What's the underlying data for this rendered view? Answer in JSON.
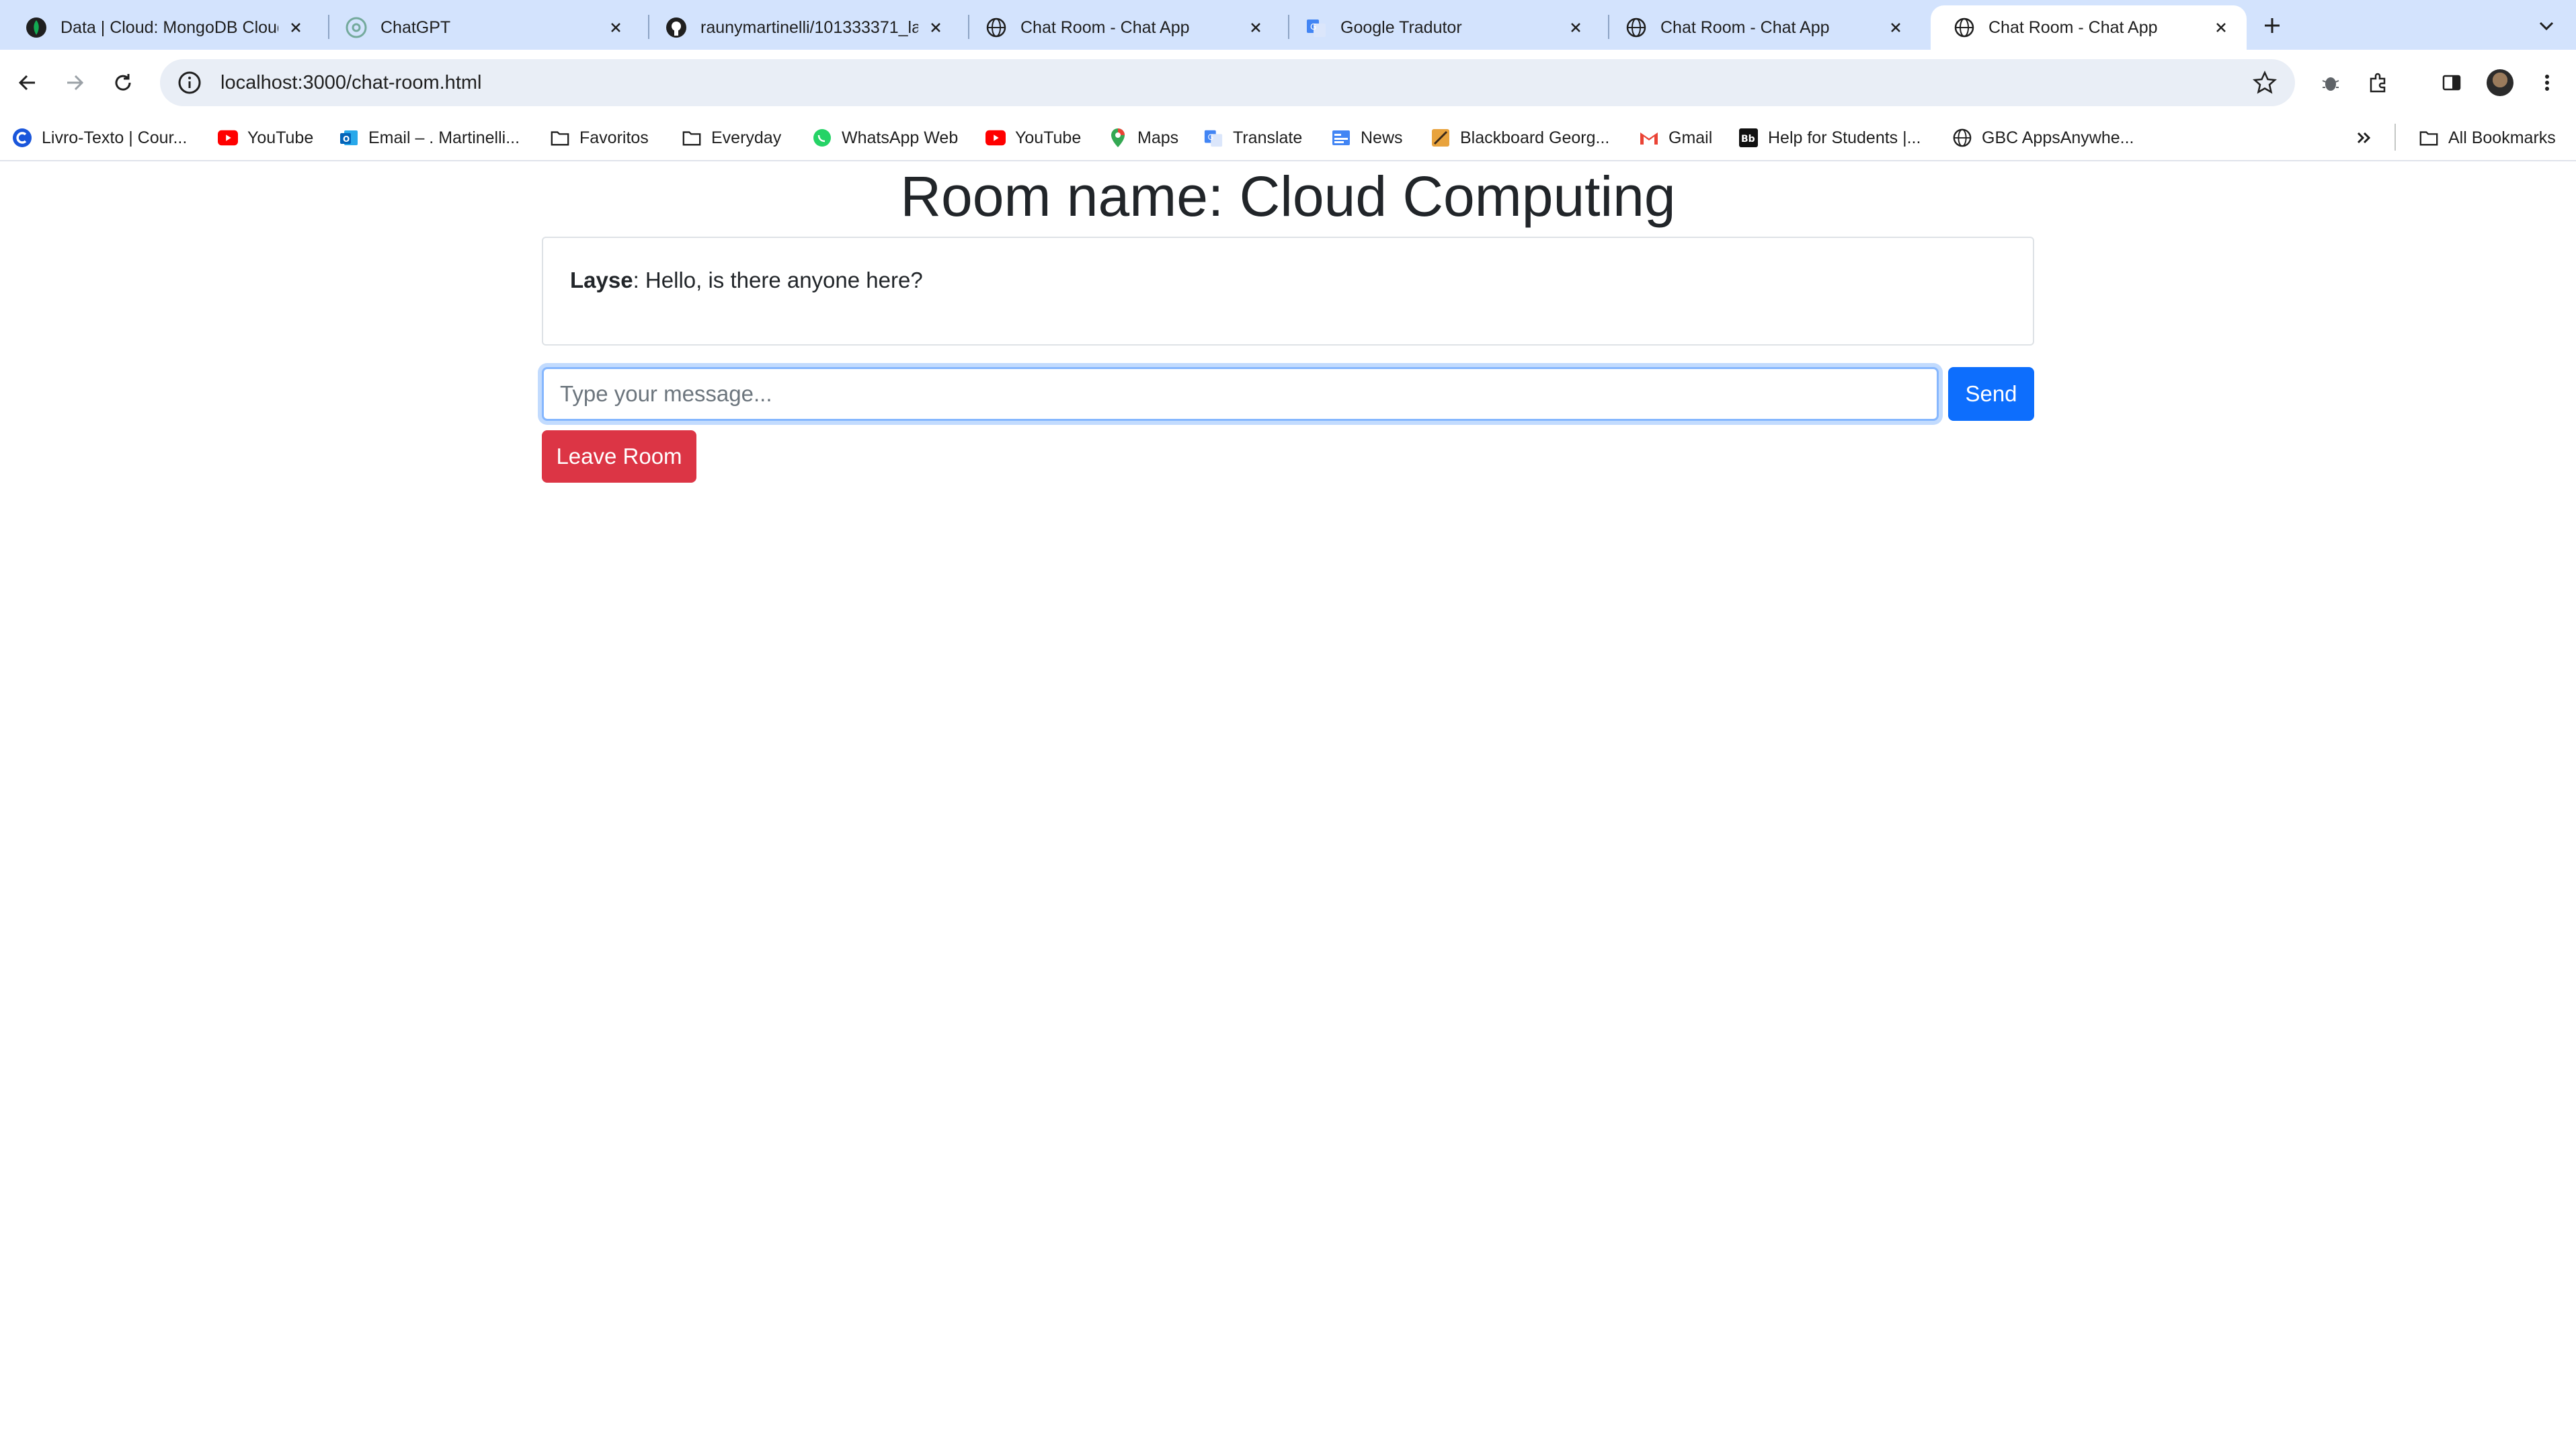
{
  "browser": {
    "tabs": [
      {
        "title": "Data | Cloud: MongoDB Cloud",
        "icon": "mongodb-leaf-icon",
        "active": false
      },
      {
        "title": "ChatGPT",
        "icon": "chatgpt-icon",
        "active": false
      },
      {
        "title": "raunymartinelli/101333371_la",
        "icon": "github-icon",
        "active": false
      },
      {
        "title": "Chat Room - Chat App",
        "icon": "globe-icon",
        "active": false
      },
      {
        "title": "Google Tradutor",
        "icon": "google-translate-icon",
        "active": false
      },
      {
        "title": "Chat Room - Chat App",
        "icon": "globe-icon",
        "active": false
      },
      {
        "title": "Chat Room - Chat App",
        "icon": "globe-icon",
        "active": true
      }
    ],
    "url": "localhost:3000/chat-room.html",
    "bookmarks": [
      {
        "label": "Livro-Texto | Cour...",
        "icon": "c-logo-icon"
      },
      {
        "label": "YouTube",
        "icon": "youtube-icon"
      },
      {
        "label": "Email – . Martinelli...",
        "icon": "outlook-icon"
      },
      {
        "label": "Favoritos",
        "icon": "folder-icon"
      },
      {
        "label": "Everyday",
        "icon": "folder-icon"
      },
      {
        "label": "WhatsApp Web",
        "icon": "whatsapp-icon"
      },
      {
        "label": "YouTube",
        "icon": "youtube-icon"
      },
      {
        "label": "Maps",
        "icon": "maps-pin-icon"
      },
      {
        "label": "Translate",
        "icon": "google-translate-icon"
      },
      {
        "label": "News",
        "icon": "google-news-icon"
      },
      {
        "label": "Blackboard Georg...",
        "icon": "blackboard-icon"
      },
      {
        "label": "Gmail",
        "icon": "gmail-icon"
      },
      {
        "label": "Help for Students |...",
        "icon": "bb-icon"
      },
      {
        "label": "GBC AppsAnywhe...",
        "icon": "globe-icon"
      }
    ],
    "all_bookmarks_label": "All Bookmarks"
  },
  "page": {
    "room_title": "Room name: Cloud Computing",
    "messages": [
      {
        "user": "Layse",
        "separator": ": ",
        "text": "Hello, is there anyone here?"
      }
    ],
    "input_placeholder": "Type your message...",
    "send_label": "Send",
    "leave_label": "Leave Room"
  },
  "colors": {
    "tabstrip": "#d3e3fd",
    "send_button": "#0d6efd",
    "leave_button": "#dc3545"
  }
}
